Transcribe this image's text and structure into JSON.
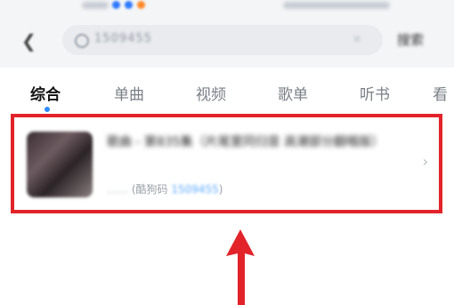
{
  "status_bar": {},
  "header": {
    "back_icon": "chevron-left-icon",
    "search": {
      "value": "1509455"
    },
    "search_button": "搜索"
  },
  "tabs": [
    "综合",
    "单曲",
    "视频",
    "歌单",
    "听书",
    "看"
  ],
  "active_tab_index": 0,
  "result": {
    "title": "歌曲 - 第835集（片尾里同归音 高潮部分翻唱版）",
    "meta_prefix": "……",
    "meta_label": "(酷狗码 ",
    "meta_code": "1509455",
    "meta_suffix": ")"
  },
  "colors": {
    "highlight_border": "#e2232a",
    "accent": "#2d8cff",
    "code_text": "#5aa9ff"
  }
}
